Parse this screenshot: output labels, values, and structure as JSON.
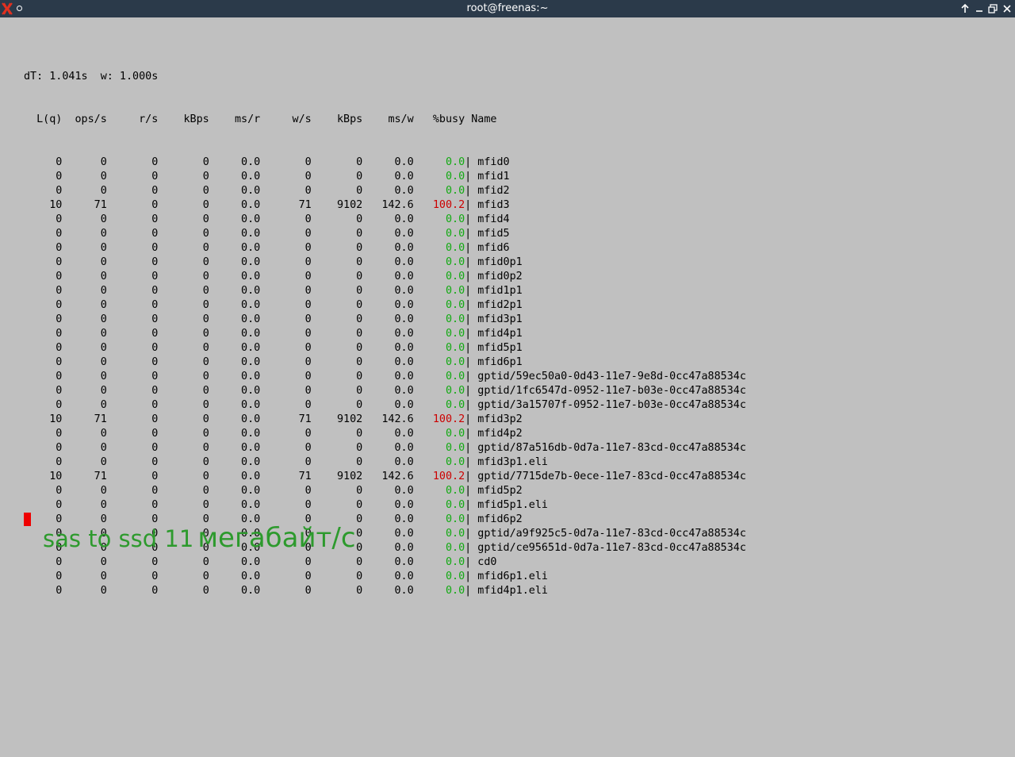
{
  "window": {
    "title": "root@freenas:~",
    "titlebar_color": "#2b3a4a",
    "icons": [
      "x-logo-icon",
      "circle-menu-icon",
      "raise-icon",
      "minimize-icon",
      "maximize-icon",
      "close-icon"
    ]
  },
  "gstat": {
    "header_line": "dT: 1.041s  w: 1.000s",
    "columns": [
      "L(q)",
      "ops/s",
      "r/s",
      "kBps",
      "ms/r",
      "w/s",
      "kBps",
      "ms/w",
      "%busy",
      "Name"
    ],
    "rows": [
      {
        "lq": "0",
        "ops": "0",
        "rs": "0",
        "rkbps": "0",
        "msr": "0.0",
        "ws": "0",
        "wkbps": "0",
        "msw": "0.0",
        "busy": "0.0",
        "name": "mfid0",
        "hot": false
      },
      {
        "lq": "0",
        "ops": "0",
        "rs": "0",
        "rkbps": "0",
        "msr": "0.0",
        "ws": "0",
        "wkbps": "0",
        "msw": "0.0",
        "busy": "0.0",
        "name": "mfid1",
        "hot": false
      },
      {
        "lq": "0",
        "ops": "0",
        "rs": "0",
        "rkbps": "0",
        "msr": "0.0",
        "ws": "0",
        "wkbps": "0",
        "msw": "0.0",
        "busy": "0.0",
        "name": "mfid2",
        "hot": false
      },
      {
        "lq": "10",
        "ops": "71",
        "rs": "0",
        "rkbps": "0",
        "msr": "0.0",
        "ws": "71",
        "wkbps": "9102",
        "msw": "142.6",
        "busy": "100.2",
        "name": "mfid3",
        "hot": true
      },
      {
        "lq": "0",
        "ops": "0",
        "rs": "0",
        "rkbps": "0",
        "msr": "0.0",
        "ws": "0",
        "wkbps": "0",
        "msw": "0.0",
        "busy": "0.0",
        "name": "mfid4",
        "hot": false
      },
      {
        "lq": "0",
        "ops": "0",
        "rs": "0",
        "rkbps": "0",
        "msr": "0.0",
        "ws": "0",
        "wkbps": "0",
        "msw": "0.0",
        "busy": "0.0",
        "name": "mfid5",
        "hot": false
      },
      {
        "lq": "0",
        "ops": "0",
        "rs": "0",
        "rkbps": "0",
        "msr": "0.0",
        "ws": "0",
        "wkbps": "0",
        "msw": "0.0",
        "busy": "0.0",
        "name": "mfid6",
        "hot": false
      },
      {
        "lq": "0",
        "ops": "0",
        "rs": "0",
        "rkbps": "0",
        "msr": "0.0",
        "ws": "0",
        "wkbps": "0",
        "msw": "0.0",
        "busy": "0.0",
        "name": "mfid0p1",
        "hot": false
      },
      {
        "lq": "0",
        "ops": "0",
        "rs": "0",
        "rkbps": "0",
        "msr": "0.0",
        "ws": "0",
        "wkbps": "0",
        "msw": "0.0",
        "busy": "0.0",
        "name": "mfid0p2",
        "hot": false
      },
      {
        "lq": "0",
        "ops": "0",
        "rs": "0",
        "rkbps": "0",
        "msr": "0.0",
        "ws": "0",
        "wkbps": "0",
        "msw": "0.0",
        "busy": "0.0",
        "name": "mfid1p1",
        "hot": false
      },
      {
        "lq": "0",
        "ops": "0",
        "rs": "0",
        "rkbps": "0",
        "msr": "0.0",
        "ws": "0",
        "wkbps": "0",
        "msw": "0.0",
        "busy": "0.0",
        "name": "mfid2p1",
        "hot": false
      },
      {
        "lq": "0",
        "ops": "0",
        "rs": "0",
        "rkbps": "0",
        "msr": "0.0",
        "ws": "0",
        "wkbps": "0",
        "msw": "0.0",
        "busy": "0.0",
        "name": "mfid3p1",
        "hot": false
      },
      {
        "lq": "0",
        "ops": "0",
        "rs": "0",
        "rkbps": "0",
        "msr": "0.0",
        "ws": "0",
        "wkbps": "0",
        "msw": "0.0",
        "busy": "0.0",
        "name": "mfid4p1",
        "hot": false
      },
      {
        "lq": "0",
        "ops": "0",
        "rs": "0",
        "rkbps": "0",
        "msr": "0.0",
        "ws": "0",
        "wkbps": "0",
        "msw": "0.0",
        "busy": "0.0",
        "name": "mfid5p1",
        "hot": false
      },
      {
        "lq": "0",
        "ops": "0",
        "rs": "0",
        "rkbps": "0",
        "msr": "0.0",
        "ws": "0",
        "wkbps": "0",
        "msw": "0.0",
        "busy": "0.0",
        "name": "mfid6p1",
        "hot": false
      },
      {
        "lq": "0",
        "ops": "0",
        "rs": "0",
        "rkbps": "0",
        "msr": "0.0",
        "ws": "0",
        "wkbps": "0",
        "msw": "0.0",
        "busy": "0.0",
        "name": "gptid/59ec50a0-0d43-11e7-9e8d-0cc47a88534c",
        "hot": false
      },
      {
        "lq": "0",
        "ops": "0",
        "rs": "0",
        "rkbps": "0",
        "msr": "0.0",
        "ws": "0",
        "wkbps": "0",
        "msw": "0.0",
        "busy": "0.0",
        "name": "gptid/1fc6547d-0952-11e7-b03e-0cc47a88534c",
        "hot": false
      },
      {
        "lq": "0",
        "ops": "0",
        "rs": "0",
        "rkbps": "0",
        "msr": "0.0",
        "ws": "0",
        "wkbps": "0",
        "msw": "0.0",
        "busy": "0.0",
        "name": "gptid/3a15707f-0952-11e7-b03e-0cc47a88534c",
        "hot": false
      },
      {
        "lq": "10",
        "ops": "71",
        "rs": "0",
        "rkbps": "0",
        "msr": "0.0",
        "ws": "71",
        "wkbps": "9102",
        "msw": "142.6",
        "busy": "100.2",
        "name": "mfid3p2",
        "hot": true
      },
      {
        "lq": "0",
        "ops": "0",
        "rs": "0",
        "rkbps": "0",
        "msr": "0.0",
        "ws": "0",
        "wkbps": "0",
        "msw": "0.0",
        "busy": "0.0",
        "name": "mfid4p2",
        "hot": false
      },
      {
        "lq": "0",
        "ops": "0",
        "rs": "0",
        "rkbps": "0",
        "msr": "0.0",
        "ws": "0",
        "wkbps": "0",
        "msw": "0.0",
        "busy": "0.0",
        "name": "gptid/87a516db-0d7a-11e7-83cd-0cc47a88534c",
        "hot": false
      },
      {
        "lq": "0",
        "ops": "0",
        "rs": "0",
        "rkbps": "0",
        "msr": "0.0",
        "ws": "0",
        "wkbps": "0",
        "msw": "0.0",
        "busy": "0.0",
        "name": "mfid3p1.eli",
        "hot": false
      },
      {
        "lq": "10",
        "ops": "71",
        "rs": "0",
        "rkbps": "0",
        "msr": "0.0",
        "ws": "71",
        "wkbps": "9102",
        "msw": "142.6",
        "busy": "100.2",
        "name": "gptid/7715de7b-0ece-11e7-83cd-0cc47a88534c",
        "hot": true
      },
      {
        "lq": "0",
        "ops": "0",
        "rs": "0",
        "rkbps": "0",
        "msr": "0.0",
        "ws": "0",
        "wkbps": "0",
        "msw": "0.0",
        "busy": "0.0",
        "name": "mfid5p2",
        "hot": false
      },
      {
        "lq": "0",
        "ops": "0",
        "rs": "0",
        "rkbps": "0",
        "msr": "0.0",
        "ws": "0",
        "wkbps": "0",
        "msw": "0.0",
        "busy": "0.0",
        "name": "mfid5p1.eli",
        "hot": false
      },
      {
        "lq": "0",
        "ops": "0",
        "rs": "0",
        "rkbps": "0",
        "msr": "0.0",
        "ws": "0",
        "wkbps": "0",
        "msw": "0.0",
        "busy": "0.0",
        "name": "mfid6p2",
        "hot": false
      },
      {
        "lq": "0",
        "ops": "0",
        "rs": "0",
        "rkbps": "0",
        "msr": "0.0",
        "ws": "0",
        "wkbps": "0",
        "msw": "0.0",
        "busy": "0.0",
        "name": "gptid/a9f925c5-0d7a-11e7-83cd-0cc47a88534c",
        "hot": false
      },
      {
        "lq": "0",
        "ops": "0",
        "rs": "0",
        "rkbps": "0",
        "msr": "0.0",
        "ws": "0",
        "wkbps": "0",
        "msw": "0.0",
        "busy": "0.0",
        "name": "gptid/ce95651d-0d7a-11e7-83cd-0cc47a88534c",
        "hot": false
      },
      {
        "lq": "0",
        "ops": "0",
        "rs": "0",
        "rkbps": "0",
        "msr": "0.0",
        "ws": "0",
        "wkbps": "0",
        "msw": "0.0",
        "busy": "0.0",
        "name": "cd0",
        "hot": false
      },
      {
        "lq": "0",
        "ops": "0",
        "rs": "0",
        "rkbps": "0",
        "msr": "0.0",
        "ws": "0",
        "wkbps": "0",
        "msw": "0.0",
        "busy": "0.0",
        "name": "mfid6p1.eli",
        "hot": false
      },
      {
        "lq": "0",
        "ops": "0",
        "rs": "0",
        "rkbps": "0",
        "msr": "0.0",
        "ws": "0",
        "wkbps": "0",
        "msw": "0.0",
        "busy": "0.0",
        "name": "mfid4p1.eli",
        "hot": false
      }
    ],
    "colors": {
      "idle_busy": "#11aa11",
      "hot_busy": "#cc0000",
      "cursor": "#ee0000"
    }
  },
  "annotation": {
    "part1": "sas to ssd 11",
    "part2": "мегабайт/с",
    "color": "#2d9a2d"
  }
}
